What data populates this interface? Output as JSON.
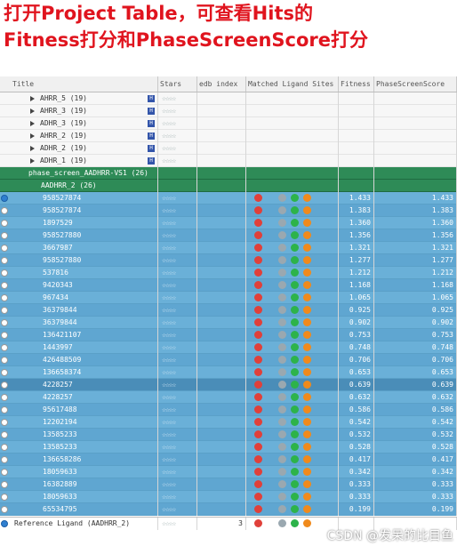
{
  "heading": {
    "line1": "打开Project Table，可查看Hits的",
    "line2": "Fitness打分和PhaseScreenScore打分"
  },
  "columns": [
    "Title",
    "Stars",
    "edb index",
    "Matched Ligand Sites",
    "Fitness",
    "PhaseScreenScore"
  ],
  "groups": [
    {
      "title": "AHRR_5 (19)",
      "stars": "☆☆☆☆"
    },
    {
      "title": "AHRR_3 (19)",
      "stars": "☆☆☆☆"
    },
    {
      "title": "ADHR_3 (19)",
      "stars": "☆☆☆☆"
    },
    {
      "title": "AHRR_2 (19)",
      "stars": "☆☆☆☆"
    },
    {
      "title": "ADHR_2 (19)",
      "stars": "☆☆☆☆"
    },
    {
      "title": "ADHR_1 (19)",
      "stars": "☆☆☆☆"
    }
  ],
  "phase_group": {
    "title": "phase_screen_AADHRR-VS1 (26)",
    "sub": "AADHRR_2 (26)"
  },
  "hits": [
    {
      "title": "958527874",
      "fitness": "1.433",
      "score": "1.433"
    },
    {
      "title": "958527874",
      "fitness": "1.383",
      "score": "1.383"
    },
    {
      "title": "1897529",
      "fitness": "1.360",
      "score": "1.360"
    },
    {
      "title": "958527880",
      "fitness": "1.356",
      "score": "1.356"
    },
    {
      "title": "3667987",
      "fitness": "1.321",
      "score": "1.321"
    },
    {
      "title": "958527880",
      "fitness": "1.277",
      "score": "1.277"
    },
    {
      "title": "537816",
      "fitness": "1.212",
      "score": "1.212"
    },
    {
      "title": "9420343",
      "fitness": "1.168",
      "score": "1.168"
    },
    {
      "title": "967434",
      "fitness": "1.065",
      "score": "1.065"
    },
    {
      "title": "36379844",
      "fitness": "0.925",
      "score": "0.925"
    },
    {
      "title": "36379844",
      "fitness": "0.902",
      "score": "0.902"
    },
    {
      "title": "136421107",
      "fitness": "0.753",
      "score": "0.753"
    },
    {
      "title": "1443997",
      "fitness": "0.748",
      "score": "0.748"
    },
    {
      "title": "426488509",
      "fitness": "0.706",
      "score": "0.706"
    },
    {
      "title": "136658374",
      "fitness": "0.653",
      "score": "0.653"
    },
    {
      "title": "4228257",
      "fitness": "0.639",
      "score": "0.639"
    },
    {
      "title": "4228257",
      "fitness": "0.632",
      "score": "0.632"
    },
    {
      "title": "95617488",
      "fitness": "0.586",
      "score": "0.586"
    },
    {
      "title": "12202194",
      "fitness": "0.542",
      "score": "0.542"
    },
    {
      "title": "13585233",
      "fitness": "0.532",
      "score": "0.532"
    },
    {
      "title": "13585233",
      "fitness": "0.528",
      "score": "0.528"
    },
    {
      "title": "136658286",
      "fitness": "0.417",
      "score": "0.417"
    },
    {
      "title": "18059633",
      "fitness": "0.342",
      "score": "0.342"
    },
    {
      "title": "16382889",
      "fitness": "0.333",
      "score": "0.333"
    },
    {
      "title": "18059633",
      "fitness": "0.333",
      "score": "0.333"
    },
    {
      "title": "65534795",
      "fitness": "0.199",
      "score": "0.199"
    }
  ],
  "hit_stars": "☆☆☆☆",
  "reference": {
    "title": "Reference Ligand (AADHRR_2)",
    "index": "3"
  },
  "watermark": "CSDN @发呆的比目鱼",
  "colors": {
    "site_red": "#e0403a",
    "site_green": "#2db34a",
    "site_orange": "#f08a1c",
    "site_grey": "#9aa8b0"
  }
}
